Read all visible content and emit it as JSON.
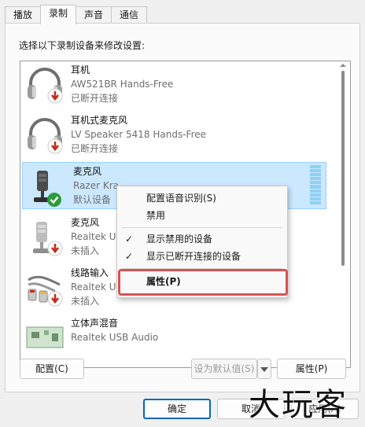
{
  "tabs": [
    "播放",
    "录制",
    "声音",
    "通信"
  ],
  "active_tab": 1,
  "instruction": "选择以下录制设备来修改设置:",
  "devices": [
    {
      "name": "耳机",
      "detail": "AW521BR Hands-Free",
      "status": "已断开连接",
      "icon": "headset-icon",
      "badge": "disconnected-badge-icon"
    },
    {
      "name": "耳机式麦克风",
      "detail": "LV Speaker 5418 Hands-Free",
      "status": "已断开连接",
      "icon": "headset-icon",
      "badge": "disconnected-badge-icon"
    },
    {
      "name": "麦克风",
      "detail": "Razer Kra",
      "status": "默认设备",
      "icon": "microphone-icon",
      "badge": "default-check-badge-icon",
      "selected": true
    },
    {
      "name": "麦克风",
      "detail": "Realtek US",
      "status": "未插入",
      "icon": "microphone-icon",
      "badge": "disconnected-badge-icon"
    },
    {
      "name": "线路输入",
      "detail": "Realtek USB Audio",
      "status": "未插入",
      "icon": "line-in-cable-icon",
      "badge": "disconnected-badge-icon"
    },
    {
      "name": "立体声混音",
      "detail": "Realtek USB Audio",
      "status": "",
      "icon": "circuit-board-icon",
      "badge": ""
    }
  ],
  "context_menu": [
    {
      "label": "配置语音识别(S)",
      "checked": false
    },
    {
      "label": "禁用",
      "checked": false
    },
    {
      "label": "显示禁用的设备",
      "checked": true
    },
    {
      "label": "显示已断开连接的设备",
      "checked": true
    },
    {
      "label": "属性(P)",
      "checked": false,
      "highlighted": true
    }
  ],
  "buttons": {
    "configure": "配置(C)",
    "set_default": "设为默认值(S)",
    "properties": "属性(P)",
    "ok": "确定",
    "cancel": "取消",
    "apply": "应用(A)"
  },
  "watermark": "大玩客",
  "colors": {
    "selection": "#cce8ff",
    "accent": "#0067c0",
    "highlight_box": "#d9534f",
    "check_green": "#2e9b3d",
    "badge_red": "#c42b1c"
  }
}
